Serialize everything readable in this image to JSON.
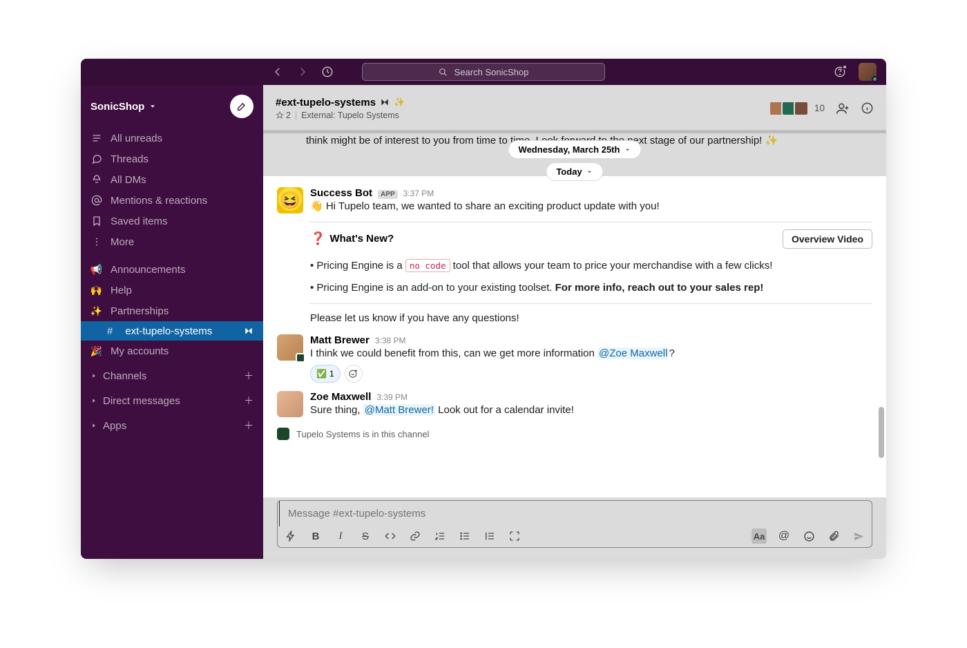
{
  "top": {
    "search_placeholder": "Search SonicShop"
  },
  "workspace": {
    "name": "SonicShop"
  },
  "nav": {
    "unreads": "All unreads",
    "threads": "Threads",
    "dms": "All DMs",
    "mentions": "Mentions & reactions",
    "saved": "Saved items",
    "more": "More"
  },
  "channels_top": [
    {
      "emoji": "📢",
      "label": "Announcements"
    },
    {
      "emoji": "🙌",
      "label": "Help"
    },
    {
      "emoji": "✨",
      "label": "Partnerships"
    }
  ],
  "active_channel": {
    "hash": "#",
    "label": "ext-tupelo-systems"
  },
  "channels_bottom": [
    {
      "emoji": "🎉",
      "label": "My accounts"
    }
  ],
  "sections": {
    "channels": "Channels",
    "dms": "Direct messages",
    "apps": "Apps"
  },
  "header": {
    "title": "#ext-tupelo-systems",
    "pinned": "2",
    "external": "External: Tupelo Systems",
    "members": "10"
  },
  "dates": {
    "prev": "Wednesday, March 25th",
    "today": "Today"
  },
  "fragment": "think might be of interest to you from time to time. Look forward to the next stage of our partnership! ✨",
  "m1": {
    "name": "Success Bot",
    "app": "APP",
    "time": "3:37 PM",
    "l1": "👋 Hi Tupelo team, we wanted to share an exciting product update with you!",
    "whats_new": "What's New?",
    "btn": "Overview Video",
    "b1a": "• Pricing Engine is a ",
    "b1code": "no code",
    "b1b": " tool that allows your team to price your merchandise with a few clicks!",
    "b2a": "• Pricing Engine is an add-on to your existing toolset. ",
    "b2bold": "For more info, reach out to your sales rep!",
    "closing": "Please let us know if you have any questions!"
  },
  "m2": {
    "name": "Matt Brewer",
    "time": "3:38 PM",
    "text": " I think we could benefit from this, can we get more information ",
    "mention": "@Zoe Maxwell",
    "tail": "?",
    "react_count": "1"
  },
  "m3": {
    "name": "Zoe Maxwell",
    "time": "3:39 PM",
    "text1": "Sure thing, ",
    "mention": "@Matt Brewer!",
    "text2": " Look out for a calendar invite!"
  },
  "ext_banner": "Tupelo Systems is in this channel",
  "composer": {
    "placeholder": "Message #ext-tupelo-systems"
  }
}
